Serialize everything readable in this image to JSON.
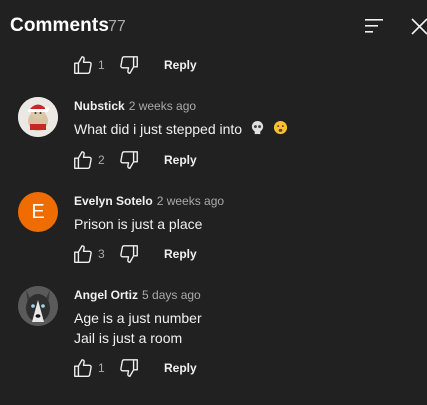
{
  "header": {
    "title": "Comments",
    "count": "77",
    "sort_icon": "sort-icon",
    "close_icon": "close-icon"
  },
  "reply_label": "Reply",
  "first_actions": {
    "likes": "1"
  },
  "comments": [
    {
      "author": "Nubstick",
      "time": "2 weeks ago",
      "text": "What did i just stepped into",
      "emojis": [
        "skull-emoji",
        "worried-face-emoji"
      ],
      "likes": "2",
      "avatar": "santa-bear-avatar"
    },
    {
      "author": "Evelyn Sotelo",
      "time": "2 weeks ago",
      "text": "Prison is just a place",
      "likes": "3",
      "avatar_letter": "E",
      "avatar_color": "#ef6c00"
    },
    {
      "author": "Angel Ortiz",
      "time": "5 days ago",
      "text_lines": [
        "Age is a just number",
        "Jail is just a room"
      ],
      "likes": "1",
      "avatar": "husky-dog-avatar"
    }
  ]
}
